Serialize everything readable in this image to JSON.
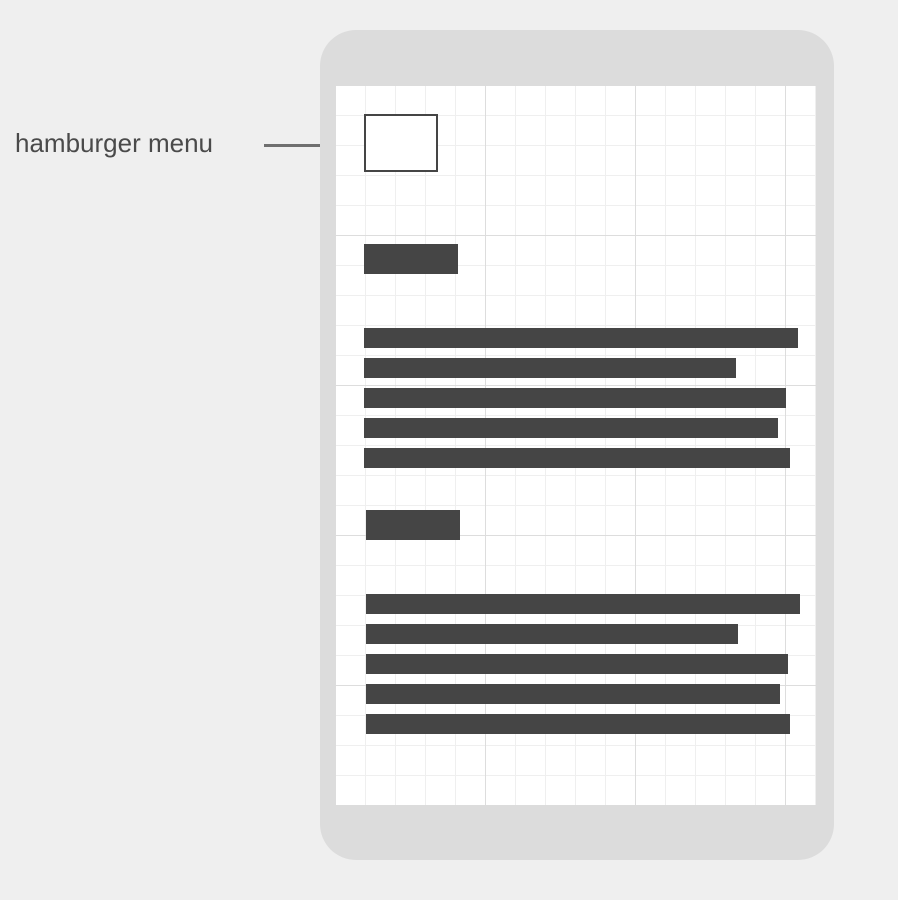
{
  "annotation": {
    "label": "hamburger menu"
  },
  "colors": {
    "background": "#efefef",
    "device": "#dcdcdc",
    "screen": "#ffffff",
    "text_block": "#454545",
    "leader": "#6f6f6f",
    "label_text": "#4a4a4a"
  },
  "wireframe": {
    "sections": [
      {
        "heading": "placeholder-heading",
        "line_count": 5
      },
      {
        "heading": "placeholder-heading",
        "line_count": 5
      }
    ]
  }
}
